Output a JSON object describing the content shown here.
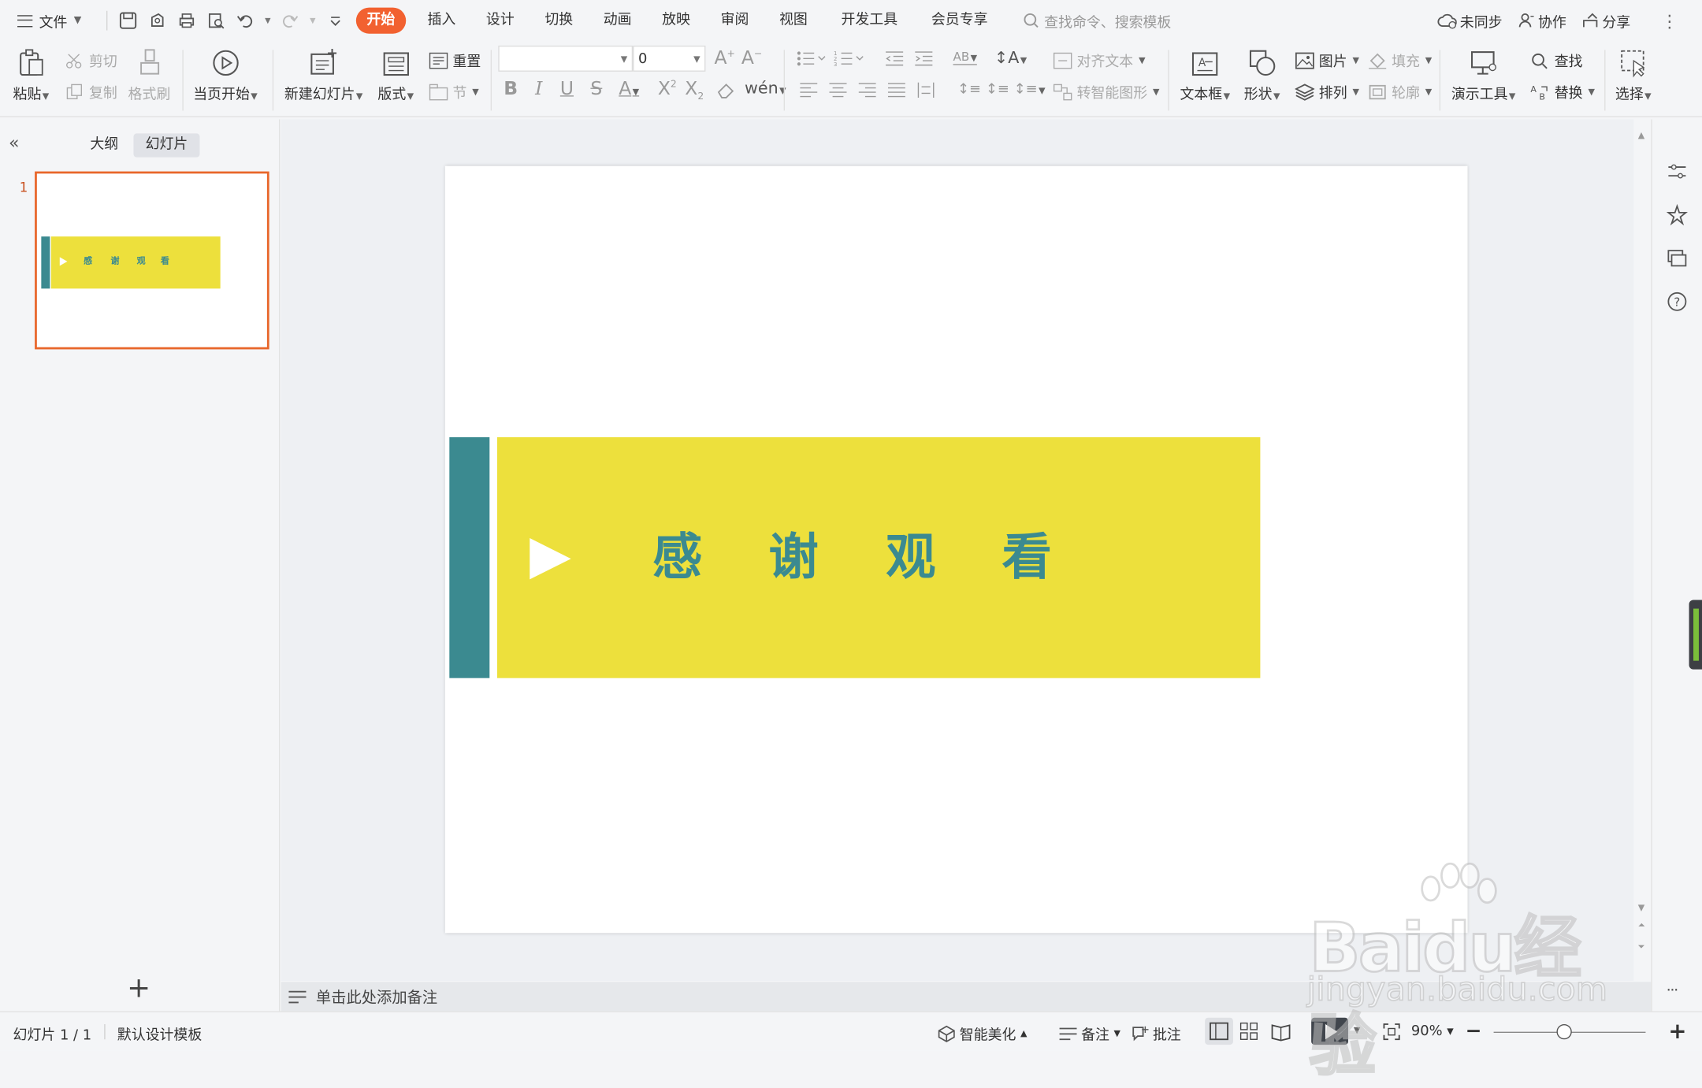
{
  "menubar": {
    "file_label": "文件",
    "tabs": [
      "开始",
      "插入",
      "设计",
      "切换",
      "动画",
      "放映",
      "审阅",
      "视图",
      "开发工具",
      "会员专享"
    ],
    "search_placeholder": "查找命令、搜索模板",
    "unsynced": "未同步",
    "collab": "协作",
    "share": "分享"
  },
  "ribbon": {
    "paste": "粘贴",
    "cut": "剪切",
    "copy": "复制",
    "format_painter": "格式刷",
    "from_current": "当页开始",
    "new_slide": "新建幻灯片",
    "layout": "版式",
    "reset": "重置",
    "section": "节",
    "font_size": "0",
    "align_text": "对齐文本",
    "to_smartart": "转智能图形",
    "textbox": "文本框",
    "shape": "形状",
    "picture": "图片",
    "arrange": "排列",
    "fill": "填充",
    "outline": "轮廓",
    "present_tools": "演示工具",
    "find": "查找",
    "replace": "替换",
    "select": "选择"
  },
  "left_panel": {
    "tab_outline": "大纲",
    "tab_slides": "幻灯片",
    "slide_number": "1",
    "add_slide": "+"
  },
  "slide": {
    "chars": [
      "感",
      "谢",
      "观",
      "看"
    ],
    "teal_color": "#3b8a90",
    "yellow_color": "#ede03c"
  },
  "notes": {
    "placeholder": "单击此处添加备注"
  },
  "status": {
    "slide_counter": "幻灯片 1 / 1",
    "template": "默认设计模板",
    "beautify": "智能美化",
    "notes": "备注",
    "comments": "批注",
    "zoom": "90%"
  },
  "watermark": {
    "brand": "Baidu经验",
    "url": "jingyan.baidu.com"
  }
}
